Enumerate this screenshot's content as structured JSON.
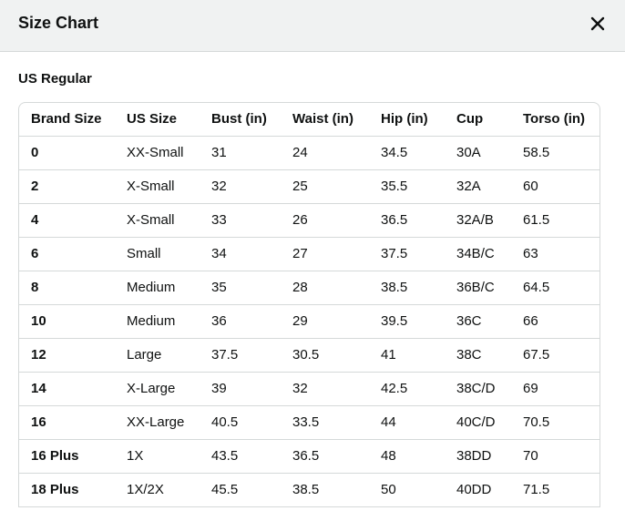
{
  "header": {
    "title": "Size Chart"
  },
  "section": {
    "title": "US Regular"
  },
  "table": {
    "columns": [
      "Brand Size",
      "US Size",
      "Bust (in)",
      "Waist (in)",
      "Hip (in)",
      "Cup",
      "Torso (in)"
    ],
    "rows": [
      [
        "0",
        "XX-Small",
        "31",
        "24",
        "34.5",
        "30A",
        "58.5"
      ],
      [
        "2",
        "X-Small",
        "32",
        "25",
        "35.5",
        "32A",
        "60"
      ],
      [
        "4",
        "X-Small",
        "33",
        "26",
        "36.5",
        "32A/B",
        "61.5"
      ],
      [
        "6",
        "Small",
        "34",
        "27",
        "37.5",
        "34B/C",
        "63"
      ],
      [
        "8",
        "Medium",
        "35",
        "28",
        "38.5",
        "36B/C",
        "64.5"
      ],
      [
        "10",
        "Medium",
        "36",
        "29",
        "39.5",
        "36C",
        "66"
      ],
      [
        "12",
        "Large",
        "37.5",
        "30.5",
        "41",
        "38C",
        "67.5"
      ],
      [
        "14",
        "X-Large",
        "39",
        "32",
        "42.5",
        "38C/D",
        "69"
      ],
      [
        "16",
        "XX-Large",
        "40.5",
        "33.5",
        "44",
        "40C/D",
        "70.5"
      ],
      [
        "16 Plus",
        "1X",
        "43.5",
        "36.5",
        "48",
        "38DD",
        "70"
      ],
      [
        "18 Plus",
        "1X/2X",
        "45.5",
        "38.5",
        "50",
        "40DD",
        "71.5"
      ]
    ]
  },
  "icons": {
    "close": "close-icon"
  }
}
